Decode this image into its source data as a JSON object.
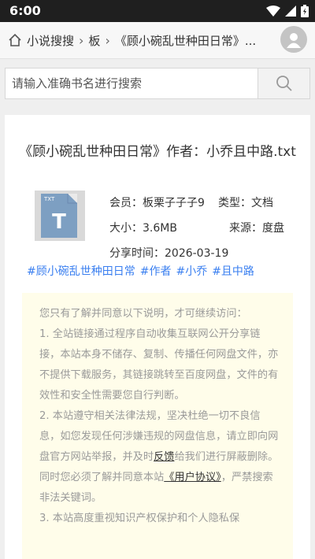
{
  "statusbar": {
    "time": "6:00"
  },
  "header": {
    "crumb1": "小说搜搜",
    "crumb2": "板",
    "crumb3": "《顾小碗乱世种田日常》..."
  },
  "search": {
    "placeholder": "请输入准确书名进行搜索"
  },
  "book": {
    "title": "《顾小碗乱世种田日常》作者：小乔且中路.txt",
    "file_badge": "TXT",
    "file_letter": "T",
    "member_label": "会员：",
    "member": "板栗子子子9",
    "type_label": "类型：",
    "type": "文档",
    "size_label": "大小：",
    "size": "3.6MB",
    "source_label": "来源：",
    "source": "度盘",
    "date_label": "分享时间：",
    "date": "2026-03-19",
    "tags": [
      "#顾小碗乱世种田日常",
      "#作者",
      "#小乔",
      "#且中路"
    ]
  },
  "notice": {
    "intro": "您只有了解并同意以下说明，才可继续访问：",
    "p1": "1. 全站链接通过程序自动收集互联网公开分享链接，本站本身不储存、复制、传播任何网盘文件，亦不提供下载服务，其链接跳转至百度网盘，文件的有效性和安全性需要您自行判断。",
    "p2a": "2. 本站遵守相关法律法规，坚决杜绝一切不良信息，如您发现任何涉嫌违规的网盘信息，请立即向网盘官方网站举报，并及时",
    "feedback": "反馈",
    "p2b": "给我们进行屏蔽删除。同时您必须了解并同意本站",
    "agreement": "《用户协议》",
    "p2c": "，严禁搜索非法关键词。",
    "p3": "3. 本站高度重视知识产权保护和个人隐私保"
  },
  "colors": {
    "tag": "#3a7ff0",
    "notice_bg": "#fffdea",
    "status_bar": "#1f1f1f"
  }
}
